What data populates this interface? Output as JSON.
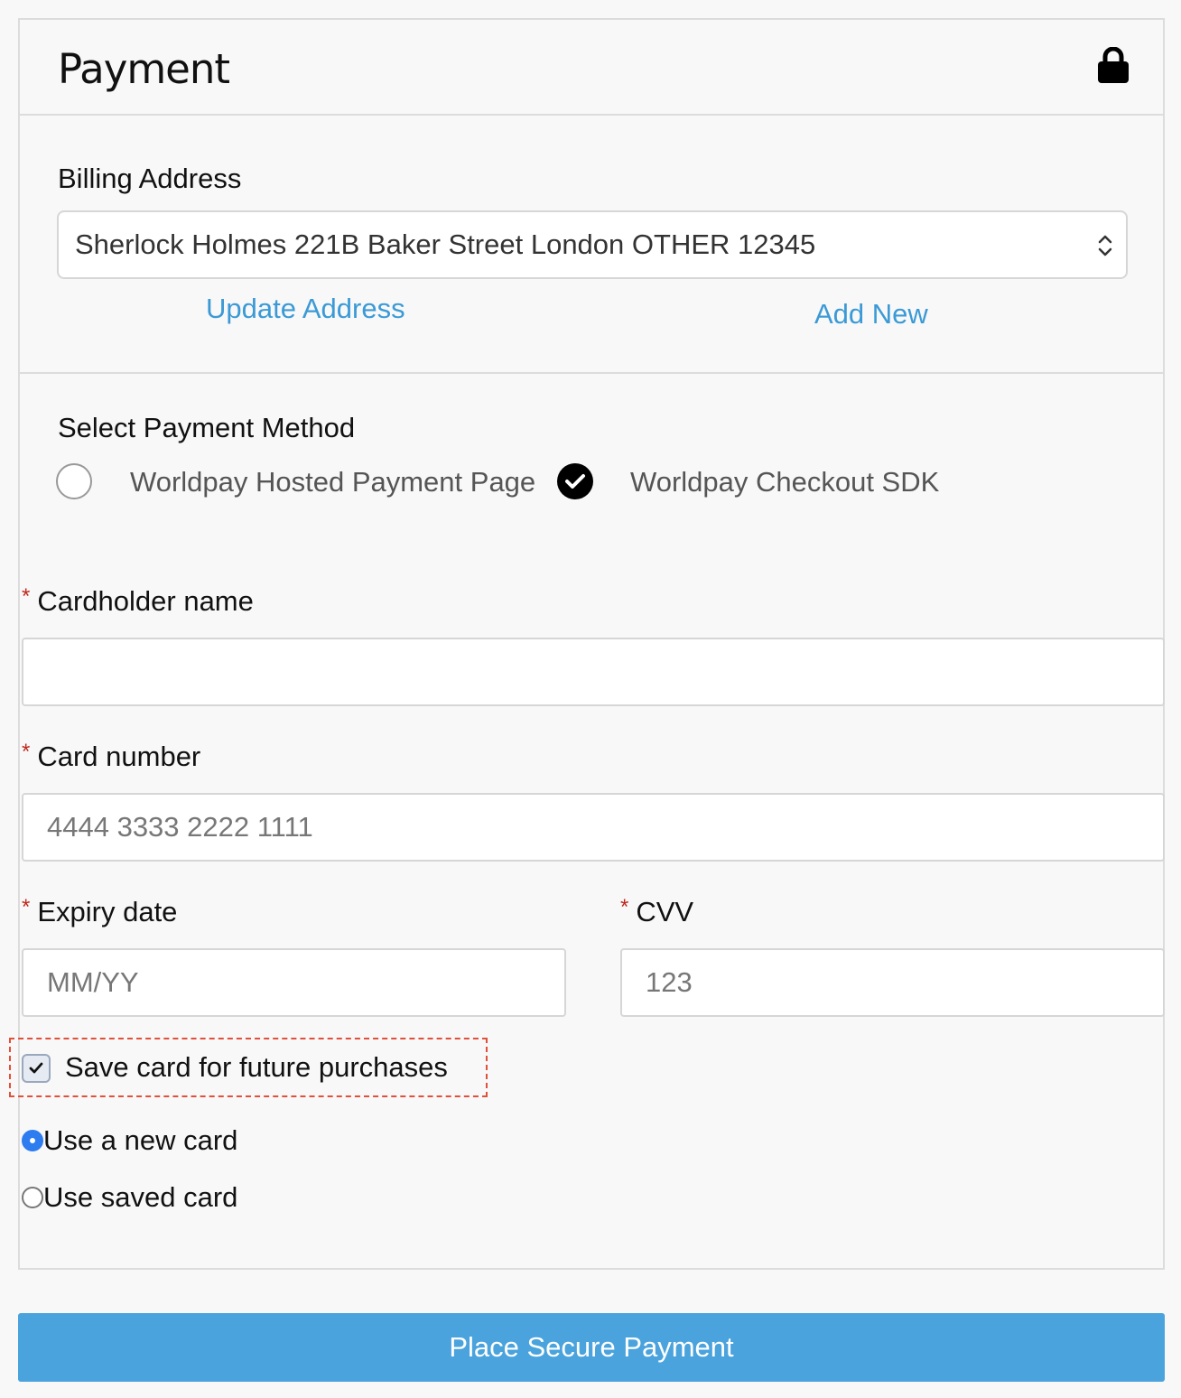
{
  "header": {
    "title": "Payment",
    "icon": "lock-icon"
  },
  "billing": {
    "label": "Billing Address",
    "selected_address": "Sherlock Holmes 221B Baker Street London OTHER 12345",
    "update_link": "Update Address",
    "add_link": "Add New"
  },
  "payment_method": {
    "label": "Select Payment Method",
    "options": [
      {
        "label": "Worldpay Hosted Payment Page",
        "selected": false
      },
      {
        "label": "Worldpay Checkout SDK",
        "selected": true
      }
    ]
  },
  "form": {
    "required_marker": "*",
    "cardholder_label": "Cardholder name",
    "cardholder_value": "",
    "card_number_label": "Card number",
    "card_number_placeholder": "4444 3333 2222 1111",
    "expiry_label": "Expiry date",
    "expiry_placeholder": "MM/YY",
    "cvv_label": "CVV",
    "cvv_placeholder": "123",
    "save_card_label": "Save card for future purchases",
    "save_card_checked": true,
    "card_choice": [
      {
        "label": "Use a new card",
        "selected": true
      },
      {
        "label": "Use saved card",
        "selected": false
      }
    ]
  },
  "submit": {
    "label": "Place Secure Payment"
  },
  "colors": {
    "link": "#3b9ad6",
    "button": "#4aa3dc",
    "required": "#c0281d",
    "radio_selected": "#2d7cf0",
    "highlight_box": "#e0503a"
  }
}
